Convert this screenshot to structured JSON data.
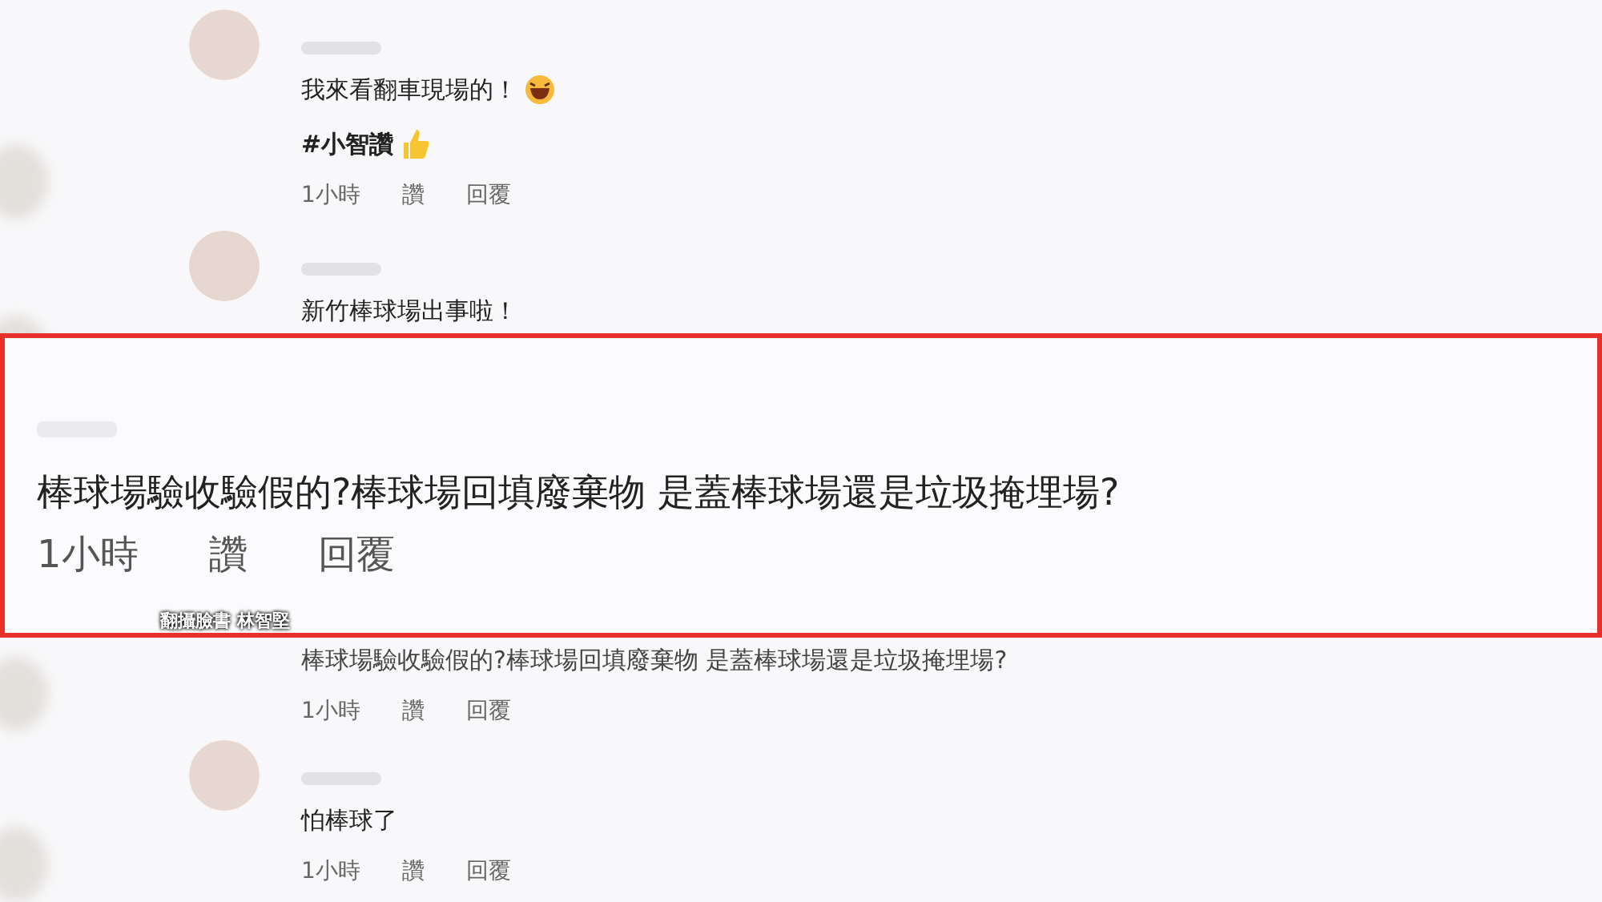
{
  "comments": [
    {
      "kind": "normal",
      "lines": [
        {
          "kind": "laugh-emoji",
          "text": "我來看翻車現場的！"
        },
        {
          "kind": "hashtag-thumb",
          "text": "#小智讚"
        }
      ],
      "meta": {
        "time": "1小時",
        "like": "讚",
        "reply": "回覆"
      }
    },
    {
      "kind": "normal",
      "lines": [
        {
          "kind": "plain",
          "text": "新竹棒球場出事啦！"
        }
      ]
    },
    {
      "kind": "covered",
      "lines": [
        {
          "kind": "plain",
          "text": "棒球場驗收驗假的?棒球場回填廢棄物 是蓋棒球場還是垃圾掩埋場?"
        }
      ],
      "meta": {
        "time": "1小時",
        "like": "讚",
        "reply": "回覆"
      }
    },
    {
      "kind": "normal",
      "lines": [
        {
          "kind": "plain",
          "text": "怕棒球了"
        }
      ],
      "meta": {
        "time": "1小時",
        "like": "讚",
        "reply": "回覆"
      }
    }
  ],
  "highlight": {
    "text": "棒球場驗收驗假的?棒球場回填廢棄物 是蓋棒球場還是垃圾掩埋場?",
    "meta": {
      "time": "1小時",
      "like": "讚",
      "reply": "回覆"
    }
  },
  "caption": "翻攝臉書 林智堅"
}
